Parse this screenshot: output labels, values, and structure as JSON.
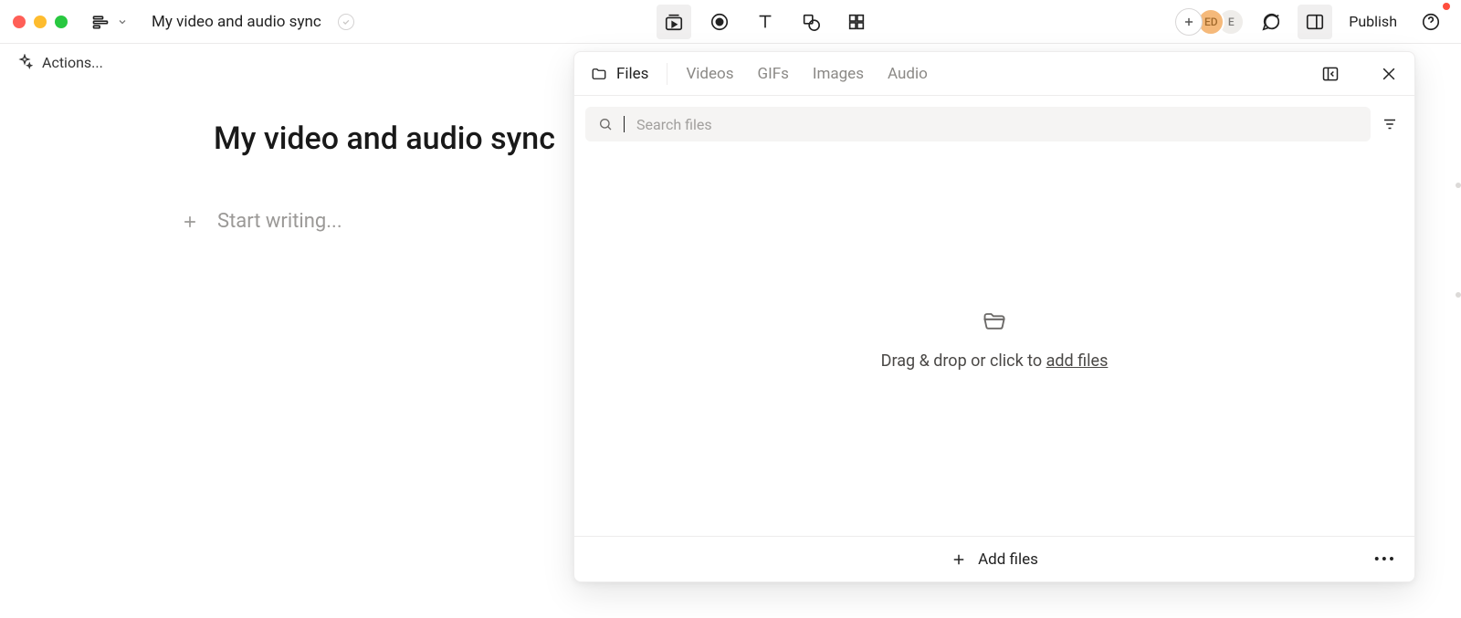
{
  "header": {
    "title": "My video and audio sync",
    "publish": "Publish",
    "avatars": [
      {
        "label": "ED"
      },
      {
        "label": "E"
      }
    ]
  },
  "actions": {
    "label": "Actions..."
  },
  "document": {
    "title": "My video and audio sync",
    "placeholder": "Start writing..."
  },
  "panel": {
    "tabs": [
      "Files",
      "Videos",
      "GIFs",
      "Images",
      "Audio"
    ],
    "active_tab": "Files",
    "search_placeholder": "Search files",
    "dropzone_prefix": "Drag & drop or click to ",
    "dropzone_link": "add files",
    "footer": {
      "add_files": "Add files"
    }
  }
}
